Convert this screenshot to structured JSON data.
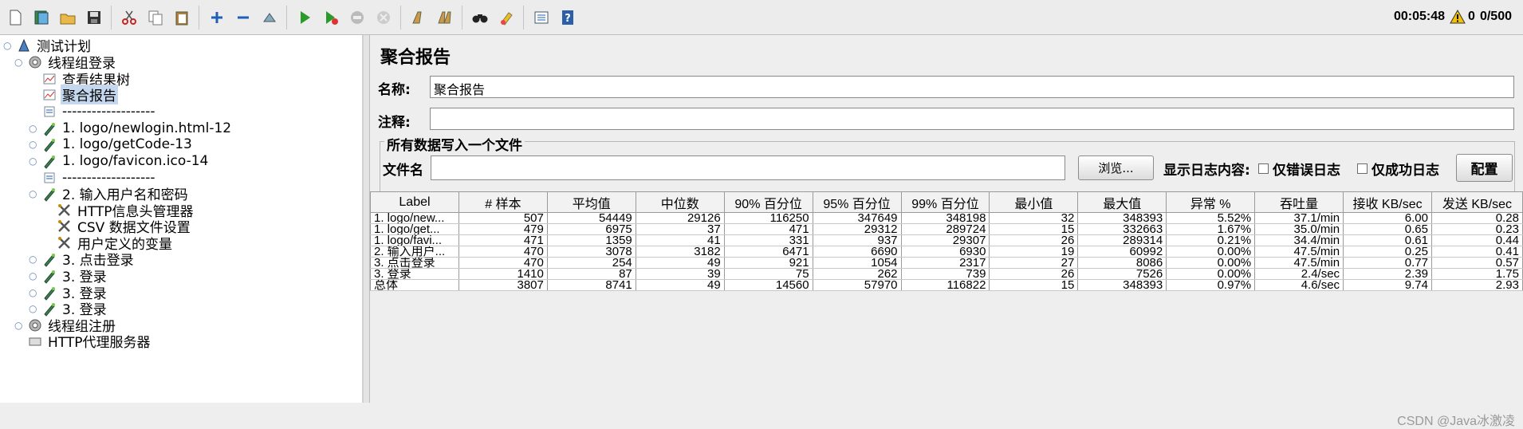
{
  "toolbar": {
    "buttons": [
      {
        "name": "new-icon"
      },
      {
        "name": "templates-icon"
      },
      {
        "name": "open-icon"
      },
      {
        "name": "save-icon"
      },
      {
        "name": "cut-icon"
      },
      {
        "name": "copy-icon"
      },
      {
        "name": "paste-icon"
      },
      {
        "name": "expand-icon"
      },
      {
        "name": "collapse-icon"
      },
      {
        "name": "toggle-icon"
      },
      {
        "name": "start-icon"
      },
      {
        "name": "start-no-pauses-icon"
      },
      {
        "name": "stop-icon"
      },
      {
        "name": "shutdown-icon"
      },
      {
        "name": "clear-icon"
      },
      {
        "name": "clear-all-icon"
      },
      {
        "name": "search-icon"
      },
      {
        "name": "reset-search-icon"
      },
      {
        "name": "function-helper-icon"
      },
      {
        "name": "help-icon"
      }
    ],
    "status": {
      "elapsed": "00:05:48",
      "warnings": "0",
      "threads": "0/500"
    }
  },
  "tree": {
    "nodes": [
      {
        "label": "测试计划",
        "icon": "test-plan-icon"
      },
      {
        "label": "线程组登录",
        "icon": "thread-group-icon"
      },
      {
        "label": "查看结果树",
        "icon": "listener-icon"
      },
      {
        "label": "聚合报告",
        "icon": "listener-icon"
      },
      {
        "label": "-------------------",
        "icon": "controller-icon"
      },
      {
        "label": "1. logo/newlogin.html-12",
        "icon": "sampler-icon"
      },
      {
        "label": "1. logo/getCode-13",
        "icon": "sampler-icon"
      },
      {
        "label": "1. logo/favicon.ico-14",
        "icon": "sampler-icon"
      },
      {
        "label": "-------------------",
        "icon": "controller-icon"
      },
      {
        "label": "2. 输入用户名和密码",
        "icon": "sampler-icon"
      },
      {
        "label": "HTTP信息头管理器",
        "icon": "config-icon"
      },
      {
        "label": "CSV 数据文件设置",
        "icon": "config-icon"
      },
      {
        "label": "用户定义的变量",
        "icon": "config-icon"
      },
      {
        "label": "3. 点击登录",
        "icon": "sampler-icon"
      },
      {
        "label": "3. 登录",
        "icon": "sampler-icon"
      },
      {
        "label": "3. 登录",
        "icon": "sampler-icon"
      },
      {
        "label": "3. 登录",
        "icon": "sampler-icon"
      },
      {
        "label": "线程组注册",
        "icon": "thread-group-icon"
      },
      {
        "label": "HTTP代理服务器",
        "icon": "proxy-icon"
      }
    ]
  },
  "report": {
    "title": "聚合报告",
    "name_label": "名称:",
    "name_value": "聚合报告",
    "comment_label": "注释:",
    "comment_value": "",
    "group_title": "所有数据写入一个文件",
    "filename_label": "文件名",
    "filename_value": "",
    "browse_label": "浏览...",
    "log_label": "显示日志内容:",
    "errors_only_label": "仅错误日志",
    "success_only_label": "仅成功日志",
    "configure_label": "配置"
  },
  "table": {
    "headers": [
      "Label",
      "# 样本",
      "平均值",
      "中位数",
      "90% 百分位",
      "95% 百分位",
      "99% 百分位",
      "最小值",
      "最大值",
      "异常 %",
      "吞吐量",
      "接收 KB/sec",
      "发送 KB/sec"
    ],
    "rows": [
      [
        "1. logo/new...",
        "507",
        "54449",
        "29126",
        "116250",
        "347649",
        "348198",
        "32",
        "348393",
        "5.52%",
        "37.1/min",
        "6.00",
        "0.28"
      ],
      [
        "1. logo/get...",
        "479",
        "6975",
        "37",
        "471",
        "29312",
        "289724",
        "15",
        "332663",
        "1.67%",
        "35.0/min",
        "0.65",
        "0.23"
      ],
      [
        "1. logo/favi...",
        "471",
        "1359",
        "41",
        "331",
        "937",
        "29307",
        "26",
        "289314",
        "0.21%",
        "34.4/min",
        "0.61",
        "0.44"
      ],
      [
        "2. 输入用户...",
        "470",
        "3078",
        "3182",
        "6471",
        "6690",
        "6930",
        "19",
        "60992",
        "0.00%",
        "47.5/min",
        "0.25",
        "0.41"
      ],
      [
        "3. 点击登录",
        "470",
        "254",
        "49",
        "921",
        "1054",
        "2317",
        "27",
        "8086",
        "0.00%",
        "47.5/min",
        "0.77",
        "0.57"
      ],
      [
        "3. 登录",
        "1410",
        "87",
        "39",
        "75",
        "262",
        "739",
        "26",
        "7526",
        "0.00%",
        "2.4/sec",
        "2.39",
        "1.75"
      ],
      [
        "总体",
        "3807",
        "8741",
        "49",
        "14560",
        "57970",
        "116822",
        "15",
        "348393",
        "0.97%",
        "4.6/sec",
        "9.74",
        "2.93"
      ]
    ]
  },
  "watermark": "CSDN @Java冰激凌"
}
